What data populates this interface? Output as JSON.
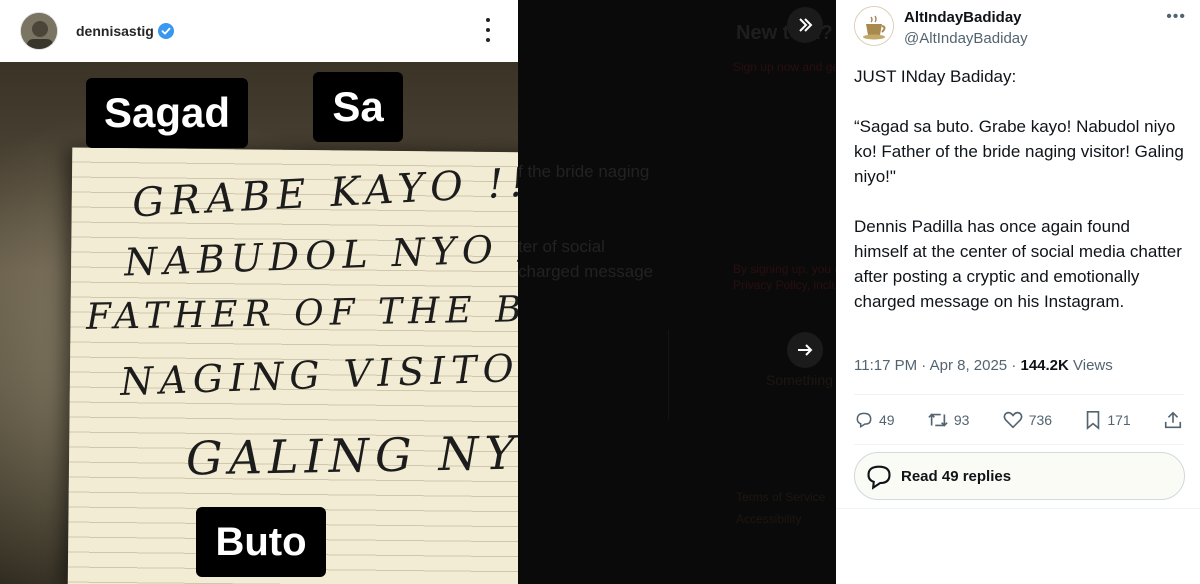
{
  "instagram": {
    "username": "dennisastig",
    "overlay_captions": [
      "Sagad",
      "Sa",
      "Buto"
    ],
    "note_lines": [
      "GRABE KAYO !!",
      "NABUDOL NYO KO!",
      "FATHER OF THE BRIDE",
      "NAGING VISITOR!",
      "GALING NYO!"
    ]
  },
  "signup_page": {
    "title": "New to X?",
    "subtitle": "Sign up now and get your own personalized timeline!",
    "snippets": [
      "f the bride naging",
      "ter of social",
      "charged message",
      "By signing up, you agree to the Terms of Service and",
      "Privacy Policy, including Cookie Use.",
      "Something went wrong.",
      "Terms of Service",
      "Accessibility"
    ]
  },
  "tweet": {
    "display_name": "AltIndayBadiday",
    "handle": "@AltIndayBadiday",
    "paragraphs": [
      "JUST INday Badiday:",
      "“Sagad sa buto. Grabe kayo! Nabudol niyo ko! Father of the bride naging visitor! Galing niyo!\"",
      "Dennis Padilla has once again found himself at the center of social media chatter after posting a cryptic and emotionally charged message on his Instagram."
    ],
    "time": "11:17 PM · Apr 8, 2025 · ",
    "views_count": "144.2K",
    "views_label": " Views",
    "replies": "49",
    "reposts": "93",
    "likes": "736",
    "bookmarks": "171",
    "read_replies": "Read 49 replies"
  },
  "colors": {
    "accent": "#1d9bf0",
    "text_secondary": "#536471",
    "verified_badge": "#3897f0"
  }
}
